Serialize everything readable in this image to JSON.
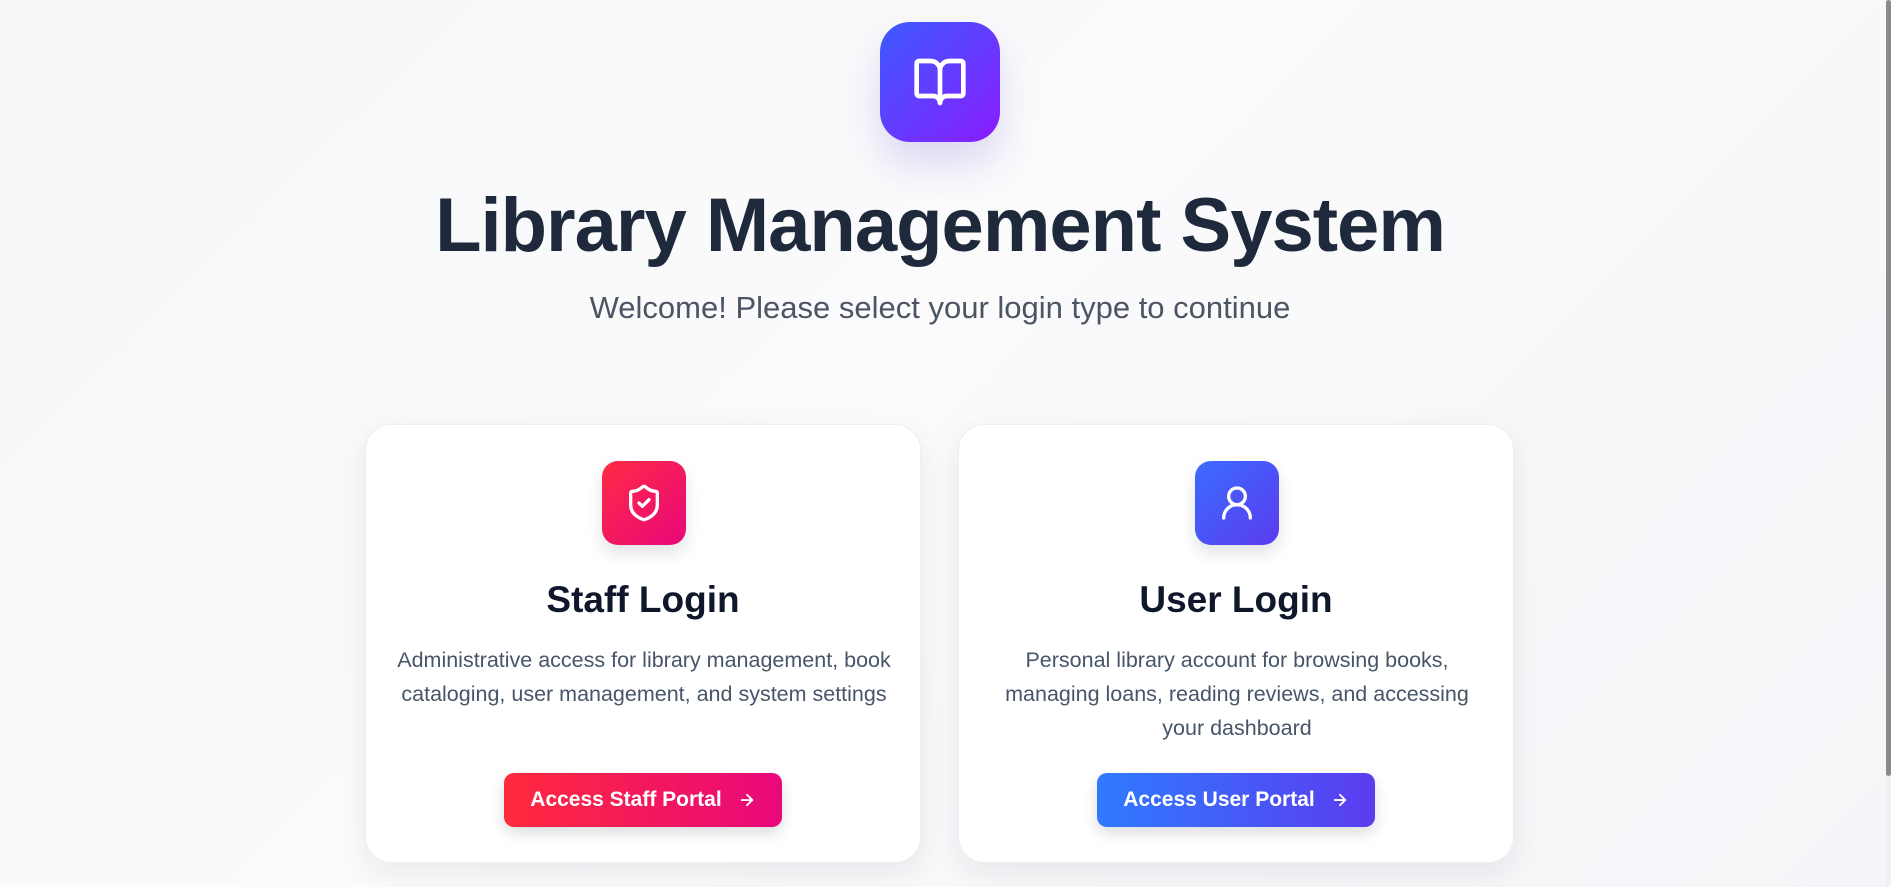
{
  "app": {
    "logo_icon": "open-book-icon",
    "title": "Library Management System",
    "subtitle": "Welcome! Please select your login type to continue"
  },
  "cards": {
    "staff": {
      "icon": "shield-check-icon",
      "title": "Staff Login",
      "description": "Administrative access for library management, book cataloging, user management, and system settings",
      "button_label": "Access Staff Portal",
      "button_icon": "arrow-right-icon",
      "accent_colors": [
        "#ff2a3d",
        "#e8087a"
      ]
    },
    "user": {
      "icon": "user-icon",
      "title": "User Login",
      "description": "Personal library account for browsing books, managing loans, reading reviews, and accessing your dashboard",
      "button_label": "Access User Portal",
      "button_icon": "arrow-right-icon",
      "accent_colors": [
        "#2f7bff",
        "#5b3cf0"
      ]
    }
  },
  "colors": {
    "logo_gradient": [
      "#3b5bff",
      "#8b1cff"
    ],
    "title": "#1e293b",
    "subtitle": "#4b5563"
  }
}
